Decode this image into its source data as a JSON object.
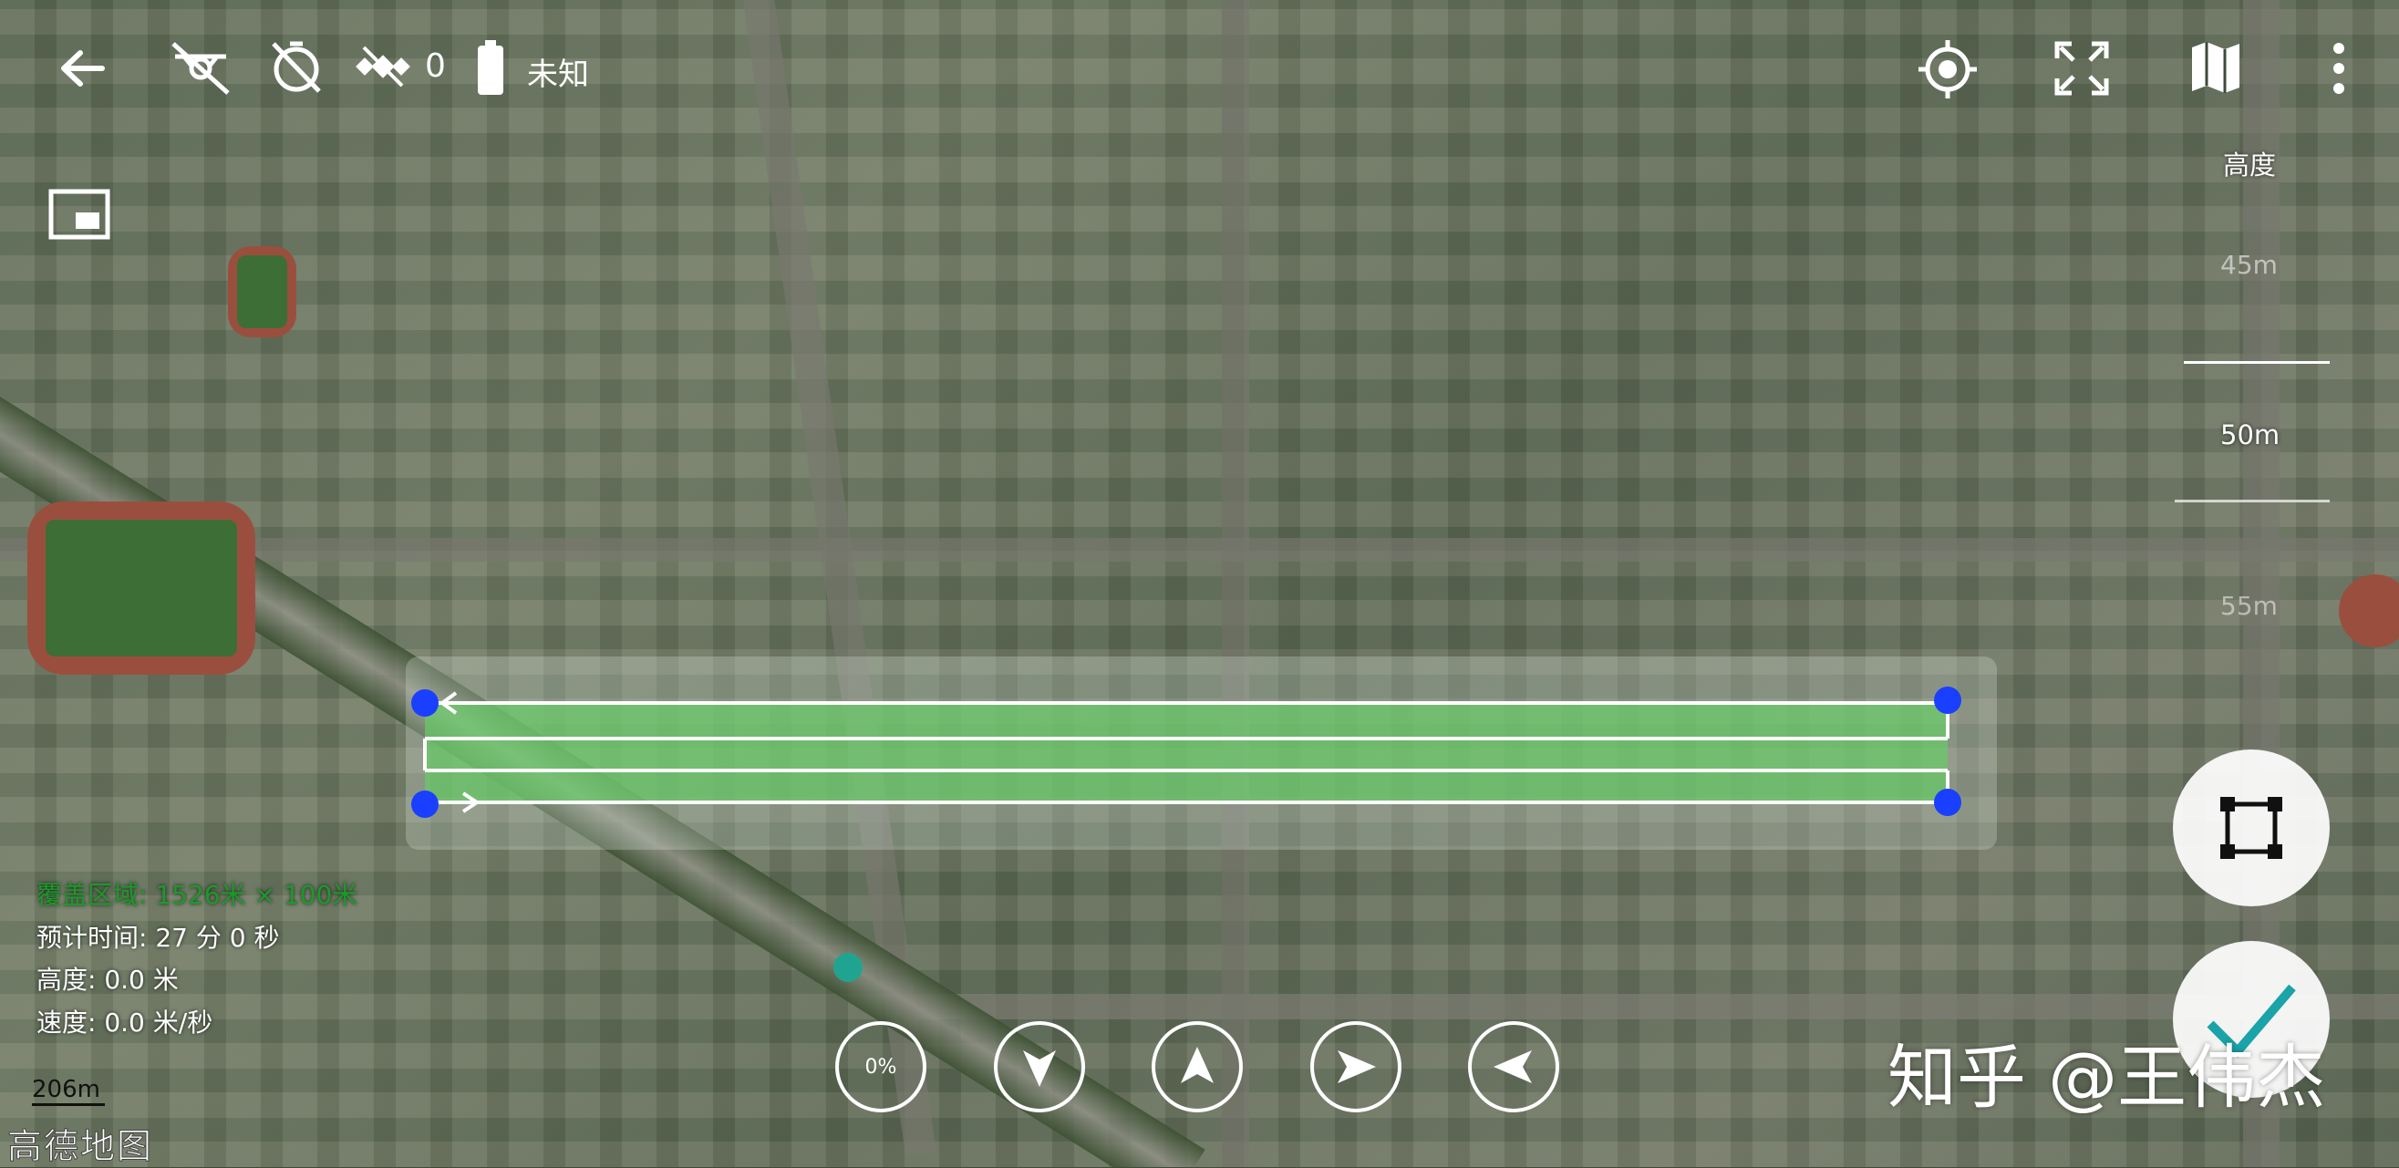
{
  "top_bar": {
    "battery_count": "0",
    "battery_status": "未知",
    "height_label": "高度",
    "icons": [
      "back-arrow-icon",
      "drone-disconnected-icon",
      "timer-off-icon",
      "satellite-icon",
      "battery-icon",
      "locate-icon",
      "fullscreen-icon",
      "map-icon",
      "more-vertical-icon"
    ]
  },
  "altitude_scale": {
    "labels": [
      "45m",
      "50m",
      "55m"
    ]
  },
  "info_panel": {
    "area": "覆盖区域: 1526米 × 100米",
    "eta": "预计时间: 27 分 0 秒",
    "height": "高度: 0.0 米",
    "speed": "速度: 0.0 米/秒"
  },
  "map": {
    "scale_label": "206m",
    "logo": "高德地图"
  },
  "controls": {
    "progress": "0%"
  },
  "watermark": "知乎 @王伟杰",
  "colors": {
    "route_fill": "#66cc66",
    "waypoint": "#1a3fff",
    "area_text": "#1c9a2a"
  }
}
